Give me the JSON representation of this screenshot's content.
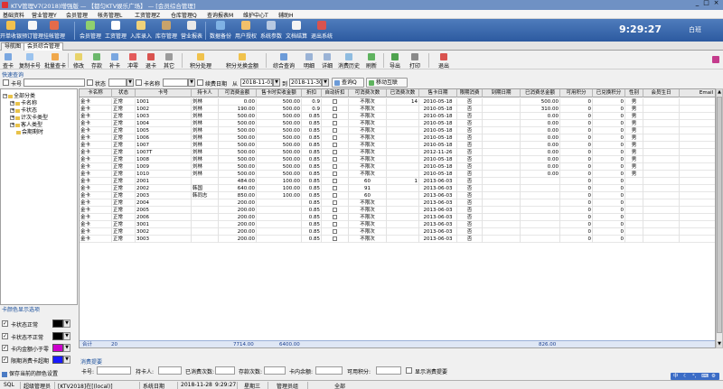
{
  "window": {
    "title": "KTV管理V7(2018)增强版 — 【都匀KTV娱乐广场】 — [会员综合管理]"
  },
  "menu": [
    "基础资料",
    "营业管理Y",
    "会员管理",
    "帐务管理L",
    "工资管理Z",
    "仓库管理Q",
    "查询报表M",
    "维护中心T",
    "辅助H"
  ],
  "banner": {
    "buttons": [
      "开单收银",
      "预订管理",
      "挂帐管理",
      "会员管理",
      "工资管理",
      "入库录入",
      "库存管理",
      "营业报表",
      "数据备份",
      "用户授权",
      "系统参数",
      "文档结算",
      "退出系统"
    ],
    "time": "9:29:27",
    "day_type": "白班"
  },
  "tabs": [
    "导航图",
    "会员综合管理"
  ],
  "toolbar": [
    "查卡",
    "复制卡号",
    "批量查卡",
    "修改",
    "存款",
    "补卡",
    "冲零",
    "退卡",
    "其它",
    "积分处理",
    "积分兑换金额",
    "综合查询",
    "明细",
    "详细",
    "消费历史",
    "刷新",
    "导出",
    "打印",
    "退出"
  ],
  "quick_query": "快速查询",
  "filters": {
    "card_no_label": "卡号",
    "status_label": "状态",
    "card_name_label": "卡名称",
    "date_check_label": "续费日期",
    "from_label": "从",
    "date_from": "2018-11-01",
    "to_label": "到",
    "date_to": "2018-11-30",
    "query_button": "查询Q",
    "move_button": "移动互联"
  },
  "tree": {
    "root": "全部分类",
    "items": [
      "卡名称",
      "卡状态",
      "计次卡类型",
      "客人类型",
      "会期剩时"
    ]
  },
  "color_options": {
    "header": "卡颜色显示选项",
    "rows": [
      {
        "label": "卡状态正常",
        "checked": true,
        "color": "#000000"
      },
      {
        "label": "卡状态不正常",
        "checked": true,
        "color": "#000000"
      },
      {
        "label": "卡内金额小于零",
        "checked": true,
        "color": "#cc00cc"
      },
      {
        "label": "限期消费卡超期",
        "checked": true,
        "color": "#1a1aff"
      }
    ],
    "save_label": "保存当前的颜色设置"
  },
  "grid": {
    "columns": [
      "卡名称",
      "状态",
      "卡号",
      "持卡人",
      "可消费金额",
      "售卡时实收金额",
      "折扣",
      "自动折扣",
      "可消费次数",
      "已消费次数",
      "售卡日期",
      "限期消费",
      "到期日期",
      "已消费总金额",
      "可用积分",
      "已兑换积分",
      "性别",
      "会员生日",
      "Email"
    ],
    "rows": [
      [
        "金卡",
        "正常",
        "1001",
        "刘林",
        "0.00",
        "500.00",
        "0.9",
        "",
        "不限次",
        "14",
        "2010-05-18",
        "否",
        "",
        "500.00",
        "0",
        "0",
        "男",
        "",
        ""
      ],
      [
        "金卡",
        "正常",
        "1002",
        "刘林",
        "190.00",
        "500.00",
        "0.9",
        "",
        "不限次",
        "",
        "2010-05-18",
        "否",
        "",
        "310.00",
        "0",
        "0",
        "男",
        "",
        ""
      ],
      [
        "金卡",
        "正常",
        "1003",
        "刘林",
        "500.00",
        "500.00",
        "0.85",
        "",
        "不限次",
        "",
        "2010-05-18",
        "否",
        "",
        "0.00",
        "0",
        "0",
        "男",
        "",
        ""
      ],
      [
        "金卡",
        "正常",
        "1004",
        "刘林",
        "500.00",
        "500.00",
        "0.85",
        "",
        "不限次",
        "",
        "2010-05-18",
        "否",
        "",
        "0.00",
        "0",
        "0",
        "男",
        "",
        ""
      ],
      [
        "金卡",
        "正常",
        "1005",
        "刘林",
        "500.00",
        "500.00",
        "0.85",
        "",
        "不限次",
        "",
        "2010-05-18",
        "否",
        "",
        "0.00",
        "0",
        "0",
        "男",
        "",
        ""
      ],
      [
        "金卡",
        "正常",
        "1006",
        "刘林",
        "500.00",
        "500.00",
        "0.85",
        "",
        "不限次",
        "",
        "2010-05-18",
        "否",
        "",
        "0.00",
        "0",
        "0",
        "男",
        "",
        ""
      ],
      [
        "金卡",
        "正常",
        "1007",
        "刘林",
        "500.00",
        "500.00",
        "0.85",
        "",
        "不限次",
        "",
        "2010-05-18",
        "否",
        "",
        "0.00",
        "0",
        "0",
        "男",
        "",
        ""
      ],
      [
        "金卡",
        "正常",
        "1007T",
        "刘林",
        "500.00",
        "500.00",
        "0.85",
        "",
        "不限次",
        "",
        "2012-11-26",
        "否",
        "",
        "0.00",
        "0",
        "0",
        "男",
        "",
        ""
      ],
      [
        "金卡",
        "正常",
        "1008",
        "刘林",
        "500.00",
        "500.00",
        "0.85",
        "",
        "不限次",
        "",
        "2010-05-18",
        "否",
        "",
        "0.00",
        "0",
        "0",
        "男",
        "",
        ""
      ],
      [
        "金卡",
        "正常",
        "1009",
        "刘林",
        "500.00",
        "500.00",
        "0.85",
        "",
        "不限次",
        "",
        "2010-05-18",
        "否",
        "",
        "0.00",
        "0",
        "0",
        "男",
        "",
        ""
      ],
      [
        "金卡",
        "正常",
        "1010",
        "刘林",
        "500.00",
        "500.00",
        "0.85",
        "",
        "不限次",
        "",
        "2010-05-18",
        "否",
        "",
        "0.00",
        "0",
        "0",
        "男",
        "",
        ""
      ],
      [
        "金卡",
        "正常",
        "2001",
        "",
        "484.00",
        "100.00",
        "0.85",
        "",
        "60",
        "1",
        "2013-06-03",
        "否",
        "",
        "",
        "0",
        "0",
        "",
        "",
        ""
      ],
      [
        "金卡",
        "正常",
        "2002",
        "韩国",
        "640.00",
        "100.00",
        "0.85",
        "",
        "91",
        "",
        "2013-06-03",
        "否",
        "",
        "",
        "0",
        "0",
        "",
        "",
        ""
      ],
      [
        "金卡",
        "正常",
        "2003",
        "韩同志",
        "850.00",
        "100.00",
        "0.85",
        "",
        "60",
        "",
        "2013-06-03",
        "否",
        "",
        "",
        "0",
        "0",
        "",
        "",
        ""
      ],
      [
        "金卡",
        "正常",
        "2004",
        "",
        "200.00",
        "",
        "0.85",
        "",
        "不限次",
        "",
        "2013-06-03",
        "否",
        "",
        "",
        "0",
        "0",
        "",
        "",
        ""
      ],
      [
        "金卡",
        "正常",
        "2005",
        "",
        "200.00",
        "",
        "0.85",
        "",
        "不限次",
        "",
        "2013-06-03",
        "否",
        "",
        "",
        "0",
        "0",
        "",
        "",
        ""
      ],
      [
        "金卡",
        "正常",
        "2006",
        "",
        "200.00",
        "",
        "0.85",
        "",
        "不限次",
        "",
        "2013-06-03",
        "否",
        "",
        "",
        "0",
        "0",
        "",
        "",
        ""
      ],
      [
        "金卡",
        "正常",
        "3001",
        "",
        "200.00",
        "",
        "0.85",
        "",
        "不限次",
        "",
        "2013-06-03",
        "否",
        "",
        "",
        "0",
        "0",
        "",
        "",
        ""
      ],
      [
        "金卡",
        "正常",
        "3002",
        "",
        "200.00",
        "",
        "0.85",
        "",
        "不限次",
        "",
        "2013-06-03",
        "否",
        "",
        "",
        "0",
        "0",
        "",
        "",
        ""
      ],
      [
        "金卡",
        "正常",
        "3003",
        "",
        "200.00",
        "",
        "0.85",
        "",
        "不限次",
        "",
        "2013-06-03",
        "否",
        "",
        "",
        "0",
        "0",
        "",
        "",
        ""
      ]
    ],
    "footer": {
      "label": "合计",
      "count": "20",
      "amount": "7714.00",
      "paid": "6400.00",
      "total_spent": "826.00"
    }
  },
  "tip": {
    "header": "消费提要",
    "card_no": "卡号:",
    "holder": "持卡人:",
    "spent_times": "已消费次数:",
    "saved_times": "存款次数:",
    "balance": "卡内余额:",
    "points": "可用积分:",
    "show_tip": "显示消费提要"
  },
  "status_bar": [
    "SQL",
    "超级管理员",
    "[KTV2018]在[(local)]",
    "系统日期",
    "2018-11-28",
    "9:29:27",
    "星期三",
    "管理员组",
    "全部"
  ],
  "ime_label": "中"
}
